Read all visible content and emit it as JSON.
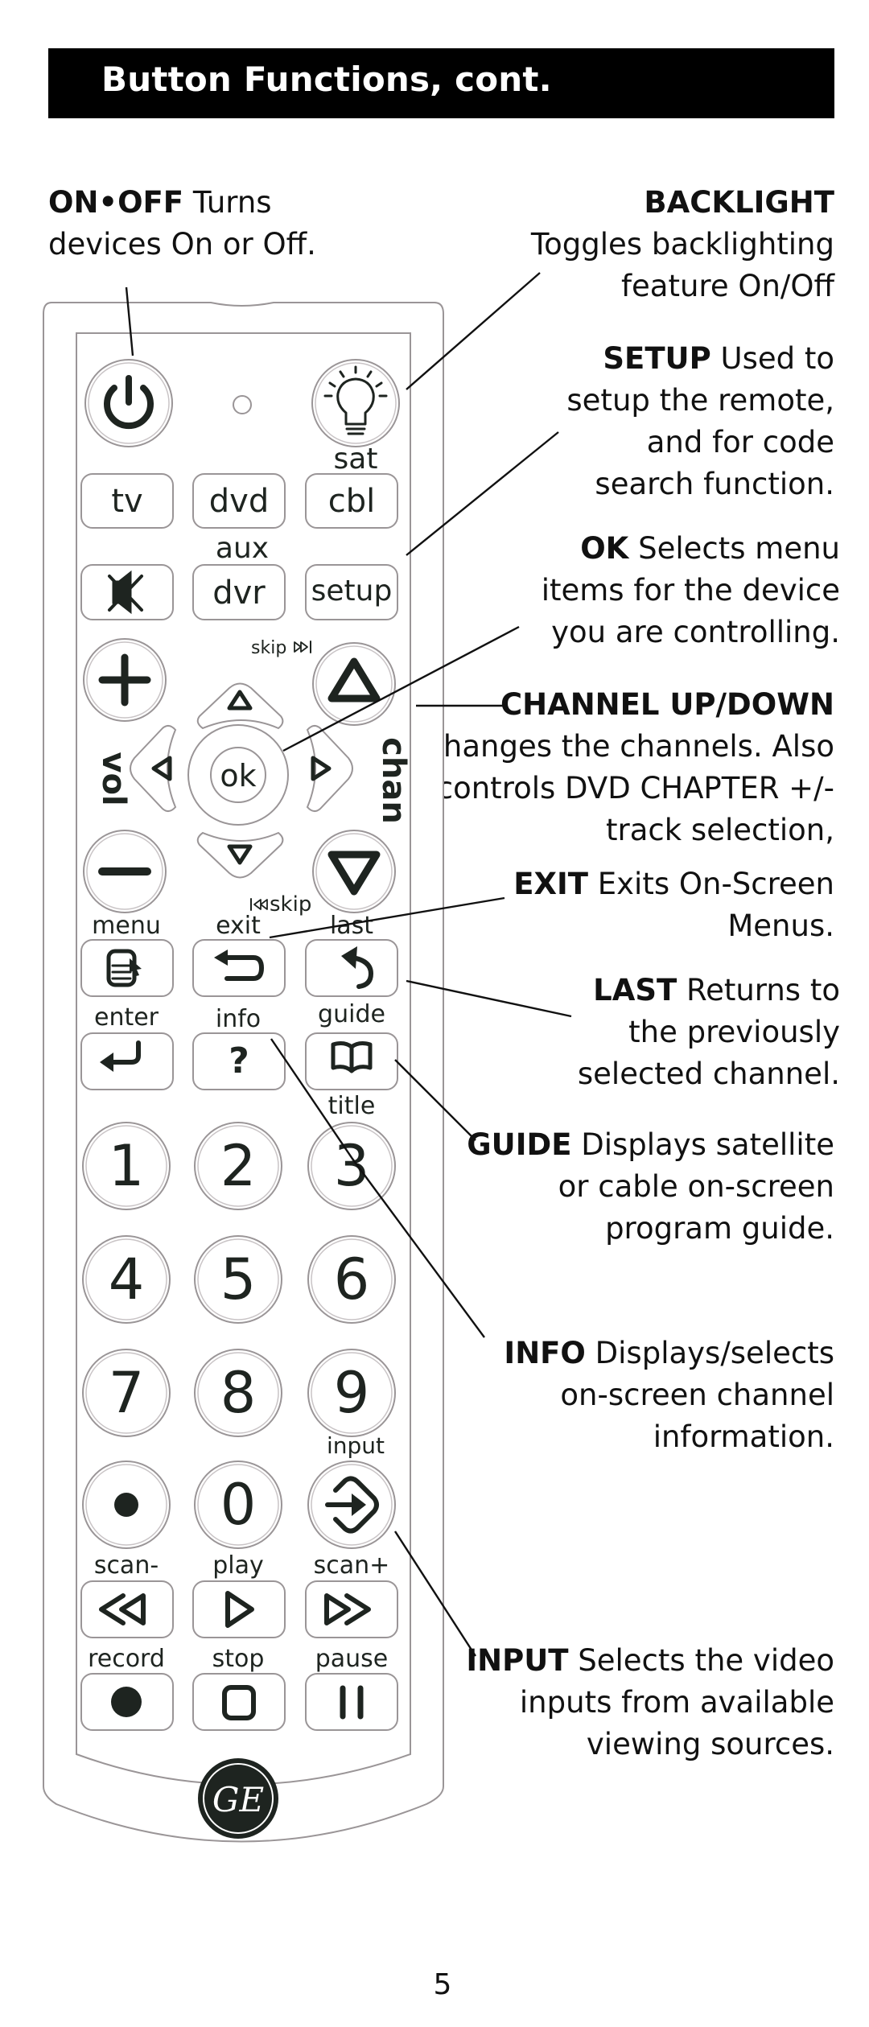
{
  "header": {
    "title": "Button Functions, cont."
  },
  "notes": {
    "onoff": {
      "key": "ON•OFF",
      "lines": [
        "Turns",
        "devices On or Off."
      ]
    },
    "backlight": {
      "key": "BACKLIGHT",
      "lines": [
        "",
        "Toggles backlighting",
        "feature On/Off"
      ]
    },
    "setup": {
      "key": "SETUP",
      "lines": [
        "Used to",
        "setup the remote,",
        "and for code",
        "search function."
      ]
    },
    "ok": {
      "key": "OK",
      "lines": [
        "Selects menu",
        "items for the device",
        "you are controlling."
      ]
    },
    "channel": {
      "key": "CHANNEL UP/DOWN",
      "lines": [
        "",
        "Changes the channels. Also",
        "controls DVD  CHAPTER +/-",
        "track selection,"
      ]
    },
    "exit": {
      "key": "EXIT",
      "lines": [
        "Exits On-Screen",
        "Menus."
      ]
    },
    "last": {
      "key": "LAST",
      "lines": [
        "Returns to",
        "the previously",
        "selected channel."
      ]
    },
    "guide": {
      "key": "GUIDE",
      "lines": [
        "Displays satellite",
        "or cable on-screen",
        "program guide."
      ]
    },
    "info": {
      "key": "INFO",
      "lines": [
        "Displays/selects",
        "on-screen channel",
        "information."
      ]
    },
    "input": {
      "key": "INPUT",
      "lines": [
        "Selects the video",
        "inputs from available",
        "viewing sources."
      ]
    }
  },
  "remote": {
    "labels": {
      "sat": "sat",
      "aux": "aux",
      "skip_fwd": "skip",
      "skip_back": "skip",
      "vol": "vol",
      "chan": "chan",
      "menu": "menu",
      "exit": "exit",
      "last": "last",
      "enter": "enter",
      "info": "info",
      "guide": "guide",
      "title": "title",
      "input": "input",
      "scan_minus": "scan-",
      "play": "play",
      "scan_plus": "scan+",
      "record": "record",
      "stop": "stop",
      "pause": "pause"
    },
    "device_buttons": [
      "tv",
      "dvd",
      "cbl"
    ],
    "second_row": {
      "dvr": "dvr",
      "setup": "setup"
    },
    "ok": "ok",
    "digits": [
      "1",
      "2",
      "3",
      "4",
      "5",
      "6",
      "7",
      "8",
      "9",
      "•",
      "0"
    ],
    "logo": "GE"
  },
  "page_number": "5"
}
